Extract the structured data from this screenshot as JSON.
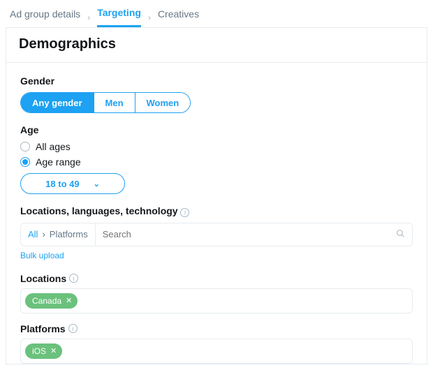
{
  "nav": {
    "crumbs": [
      "Ad group details",
      "Targeting",
      "Creatives"
    ],
    "active_index": 1
  },
  "header": {
    "title": "Demographics"
  },
  "gender": {
    "label": "Gender",
    "options": [
      "Any gender",
      "Men",
      "Women"
    ],
    "selected_index": 0
  },
  "age": {
    "label": "Age",
    "radios": [
      "All ages",
      "Age range"
    ],
    "selected_index": 1,
    "range_value": "18 to 49"
  },
  "llt": {
    "label": "Locations, languages, technology",
    "bc_all": "All",
    "bc_current": "Platforms",
    "search_placeholder": "Search",
    "bulk_link": "Bulk upload"
  },
  "locations": {
    "label": "Locations",
    "chips": [
      "Canada"
    ]
  },
  "platforms": {
    "label": "Platforms",
    "chips": [
      "iOS"
    ]
  }
}
